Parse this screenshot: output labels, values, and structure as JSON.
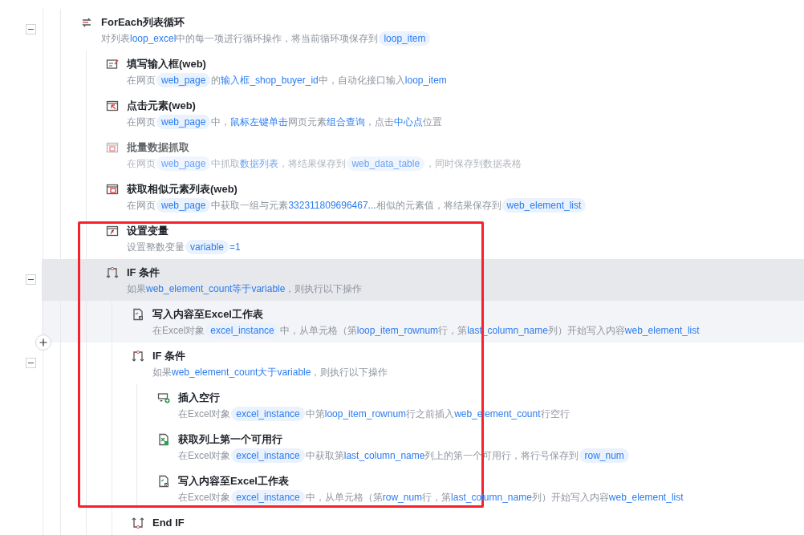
{
  "annotation_visible": true,
  "steps": [
    {
      "kind": "loop",
      "title": "ForEach列表循环",
      "expanded": true,
      "selected": false,
      "hovered": false,
      "disabled": false,
      "description": [
        {
          "kind": "plain",
          "text": "对列表"
        },
        {
          "kind": "var",
          "text": "loop_excel"
        },
        {
          "kind": "plain",
          "text": "中的每一项进行循环操作，将当前循环项保存到"
        },
        {
          "kind": "chip",
          "text": "loop_item"
        }
      ],
      "children": [
        {
          "kind": "input",
          "title": "填写输入框(web)",
          "selected": false,
          "hovered": false,
          "disabled": false,
          "description": [
            {
              "kind": "plain",
              "text": "在网页"
            },
            {
              "kind": "chip",
              "text": "web_page"
            },
            {
              "kind": "plain",
              "text": "的"
            },
            {
              "kind": "var",
              "text": "输入框_shop_buyer_id"
            },
            {
              "kind": "plain",
              "text": "中，自动化接口输入"
            },
            {
              "kind": "var",
              "text": "loop_item"
            }
          ]
        },
        {
          "kind": "click",
          "title": "点击元素(web)",
          "selected": false,
          "hovered": false,
          "disabled": false,
          "description": [
            {
              "kind": "plain",
              "text": "在网页"
            },
            {
              "kind": "chip",
              "text": "web_page"
            },
            {
              "kind": "plain",
              "text": "中，"
            },
            {
              "kind": "var",
              "text": "鼠标左键单击"
            },
            {
              "kind": "plain",
              "text": "网页元素"
            },
            {
              "kind": "var",
              "text": "组合查询"
            },
            {
              "kind": "plain",
              "text": "，点击"
            },
            {
              "kind": "var",
              "text": "中心点"
            },
            {
              "kind": "plain",
              "text": "位置"
            }
          ]
        },
        {
          "kind": "scrape",
          "title": "批量数据抓取",
          "selected": false,
          "hovered": false,
          "disabled": true,
          "description": [
            {
              "kind": "plain",
              "text": "在网页"
            },
            {
              "kind": "chip",
              "text": "web_page"
            },
            {
              "kind": "plain",
              "text": "中抓取"
            },
            {
              "kind": "var",
              "text": "数据列表"
            },
            {
              "kind": "plain",
              "text": "，将结果保存到"
            },
            {
              "kind": "chip",
              "text": "web_data_table"
            },
            {
              "kind": "plain",
              "text": "，同时保存到数据表格"
            }
          ]
        },
        {
          "kind": "similar",
          "title": "获取相似元素列表(web)",
          "selected": false,
          "hovered": false,
          "disabled": false,
          "description": [
            {
              "kind": "plain",
              "text": "在网页"
            },
            {
              "kind": "chip",
              "text": "web_page"
            },
            {
              "kind": "plain",
              "text": "中获取一组与元素"
            },
            {
              "kind": "var",
              "text": "332311809696467..."
            },
            {
              "kind": "plain",
              "text": "相似的元素值，将结果保存到"
            },
            {
              "kind": "chip",
              "text": "web_element_list"
            }
          ]
        },
        {
          "kind": "variable",
          "title": "设置变量",
          "selected": false,
          "hovered": false,
          "disabled": false,
          "description": [
            {
              "kind": "plain",
              "text": "设置整数变量"
            },
            {
              "kind": "chip",
              "text": "variable"
            },
            {
              "kind": "var",
              "text": "=1"
            }
          ]
        },
        {
          "kind": "if",
          "title": "IF 条件",
          "expanded": true,
          "selected": true,
          "hovered": false,
          "disabled": false,
          "description": [
            {
              "kind": "plain",
              "text": "如果"
            },
            {
              "kind": "var",
              "text": "web_element_count等于variable"
            },
            {
              "kind": "plain",
              "text": "，则执行以下操作"
            }
          ],
          "children": [
            {
              "kind": "excel_write",
              "title": "写入内容至Excel工作表",
              "selected": false,
              "hovered": true,
              "disabled": false,
              "description": [
                {
                  "kind": "plain",
                  "text": "在Excel对象"
                },
                {
                  "kind": "chip",
                  "text": "excel_instance"
                },
                {
                  "kind": "plain",
                  "text": "中，从单元格（第"
                },
                {
                  "kind": "var",
                  "text": "loop_item_rownum"
                },
                {
                  "kind": "plain",
                  "text": "行，第"
                },
                {
                  "kind": "var",
                  "text": "last_column_name"
                },
                {
                  "kind": "plain",
                  "text": "列）开始写入内容"
                },
                {
                  "kind": "var",
                  "text": "web_element_list"
                }
              ]
            },
            {
              "kind": "if",
              "title": "IF 条件",
              "expanded": true,
              "selected": false,
              "hovered": false,
              "disabled": false,
              "description": [
                {
                  "kind": "plain",
                  "text": "如果"
                },
                {
                  "kind": "var",
                  "text": "web_element_count大于variable"
                },
                {
                  "kind": "plain",
                  "text": "，则执行以下操作"
                }
              ],
              "children": [
                {
                  "kind": "insert_row",
                  "title": "插入空行",
                  "selected": false,
                  "hovered": false,
                  "disabled": false,
                  "description": [
                    {
                      "kind": "plain",
                      "text": "在Excel对象"
                    },
                    {
                      "kind": "chip",
                      "text": "excel_instance"
                    },
                    {
                      "kind": "plain",
                      "text": "中第"
                    },
                    {
                      "kind": "var",
                      "text": "loop_item_rownum"
                    },
                    {
                      "kind": "plain",
                      "text": "行之前插入"
                    },
                    {
                      "kind": "var",
                      "text": "web_element_count"
                    },
                    {
                      "kind": "plain",
                      "text": "行空行"
                    }
                  ]
                },
                {
                  "kind": "excel_find",
                  "title": "获取列上第一个可用行",
                  "selected": false,
                  "hovered": false,
                  "disabled": false,
                  "description": [
                    {
                      "kind": "plain",
                      "text": "在Excel对象"
                    },
                    {
                      "kind": "chip",
                      "text": "excel_instance"
                    },
                    {
                      "kind": "plain",
                      "text": "中获取第"
                    },
                    {
                      "kind": "var",
                      "text": "last_column_name"
                    },
                    {
                      "kind": "plain",
                      "text": "列上的第一个可用行，将行号保存到"
                    },
                    {
                      "kind": "chip",
                      "text": "row_num"
                    }
                  ]
                },
                {
                  "kind": "excel_write",
                  "title": "写入内容至Excel工作表",
                  "selected": false,
                  "hovered": false,
                  "disabled": false,
                  "description": [
                    {
                      "kind": "plain",
                      "text": "在Excel对象"
                    },
                    {
                      "kind": "chip",
                      "text": "excel_instance"
                    },
                    {
                      "kind": "plain",
                      "text": "中，从单元格（第"
                    },
                    {
                      "kind": "var",
                      "text": "row_num"
                    },
                    {
                      "kind": "plain",
                      "text": "行，第"
                    },
                    {
                      "kind": "var",
                      "text": "last_column_name"
                    },
                    {
                      "kind": "plain",
                      "text": "列）开始写入内容"
                    },
                    {
                      "kind": "var",
                      "text": "web_element_list"
                    }
                  ]
                }
              ]
            },
            {
              "kind": "endif",
              "title": "End IF",
              "selected": false,
              "hovered": false,
              "disabled": false
            }
          ]
        }
      ]
    }
  ]
}
